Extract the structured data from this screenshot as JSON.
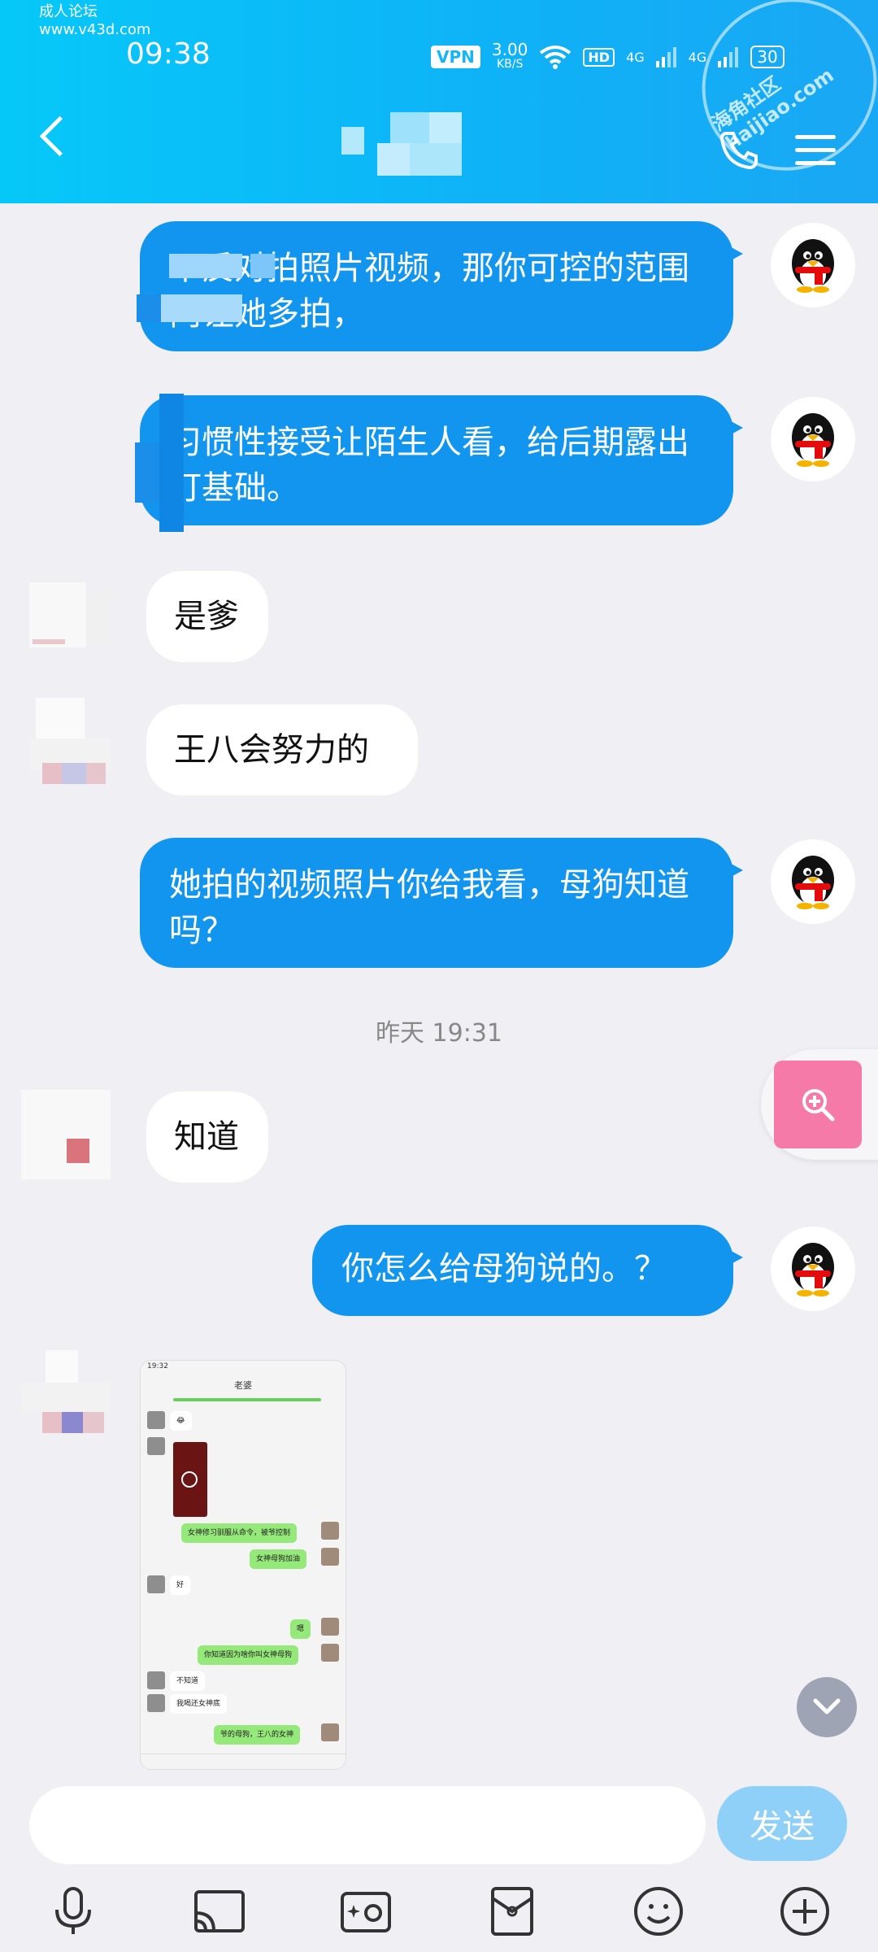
{
  "status_bar": {
    "watermark_top": "成人论坛\nwww.v43d.com",
    "time": "09:38",
    "vpn": "VPN",
    "netspeed_value": "3.00",
    "netspeed_unit": "KB/S",
    "hd": "HD",
    "net_left": "4G",
    "net_right": "4G",
    "battery": "30"
  },
  "header": {
    "stamp_text": "海角社区 haijiao.com"
  },
  "messages": [
    {
      "side": "out",
      "text": "不反对拍照片视频，那你可控的范围内让她多拍，"
    },
    {
      "side": "out",
      "text": "习惯性接受让陌生人看，给后期露出打基础。"
    },
    {
      "side": "in",
      "text": "是爹"
    },
    {
      "side": "in",
      "text": "王八会努力的"
    },
    {
      "side": "out",
      "text": "她拍的视频照片你给我看，母狗知道吗？"
    },
    {
      "side": "in",
      "text": "知道"
    },
    {
      "side": "out",
      "text": "你怎么给母狗说的。？"
    }
  ],
  "timestamp": "昨天 19:31",
  "screenshot": {
    "time": "19:32",
    "title": "老婆",
    "msgs": [
      {
        "type": "w",
        "text": "😂"
      },
      {
        "type": "g",
        "text": "女神修习驯服从命令，被爷控制"
      },
      {
        "type": "g",
        "text": "女神母狗加油"
      },
      {
        "type": "w",
        "text": "好"
      },
      {
        "type": "g",
        "text": "嗯"
      },
      {
        "type": "g",
        "text": "你知道因为啥你叫女神母狗"
      },
      {
        "type": "w",
        "text": "不知道"
      },
      {
        "type": "w",
        "text": "我喝还女神底"
      },
      {
        "type": "g",
        "text": "爷的母狗，王八的女神"
      }
    ]
  },
  "input": {
    "send_label": "发送"
  },
  "colors": {
    "header_start": "#06c8f8",
    "bubble_out": "#1295ef",
    "bubble_in": "#ffffff",
    "send": "#8fd0f8",
    "zoom": "#f57aa8"
  }
}
